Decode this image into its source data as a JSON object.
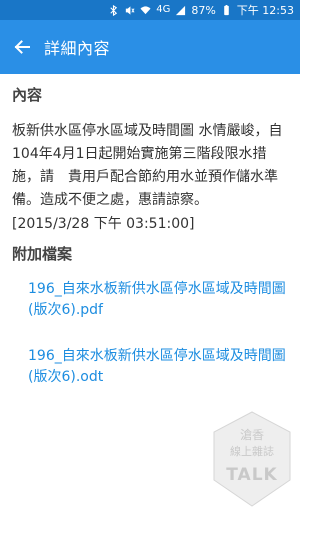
{
  "status_bar": {
    "battery": "87%",
    "time": "下午 12:53",
    "network": "4G",
    "icons": [
      "bluetooth-icon",
      "mute-icon",
      "wifi-icon",
      "signal-icon",
      "battery-icon"
    ]
  },
  "app_bar": {
    "back_icon": "arrow-left-icon",
    "title": "詳細內容"
  },
  "content_section": {
    "heading": "內容",
    "body": "板新供水區停水區域及時間圖 水情嚴峻，自104年4月1日起開始實施第三階段限水措施，請　貴用戶配合節約用水並預作儲水準備。造成不便之處，惠請諒察。",
    "timestamp": "[2015/3/28 下午 03:51:00]"
  },
  "attachments_section": {
    "heading": "附加檔案",
    "files": [
      {
        "name": "196_自來水板新供水區停水區域及時間圖 (版次6).pdf"
      },
      {
        "name": "196_自來水板新供水區停水區域及時間圖 (版次6).odt"
      }
    ]
  },
  "watermark": {
    "line1": "滄香",
    "line2": "線上雜誌",
    "line3": "TALK"
  },
  "colors": {
    "status_bar": "#1976c7",
    "app_bar": "#2a8fe6",
    "link": "#1d8de0",
    "heading": "#444444",
    "body_text": "#333333"
  }
}
